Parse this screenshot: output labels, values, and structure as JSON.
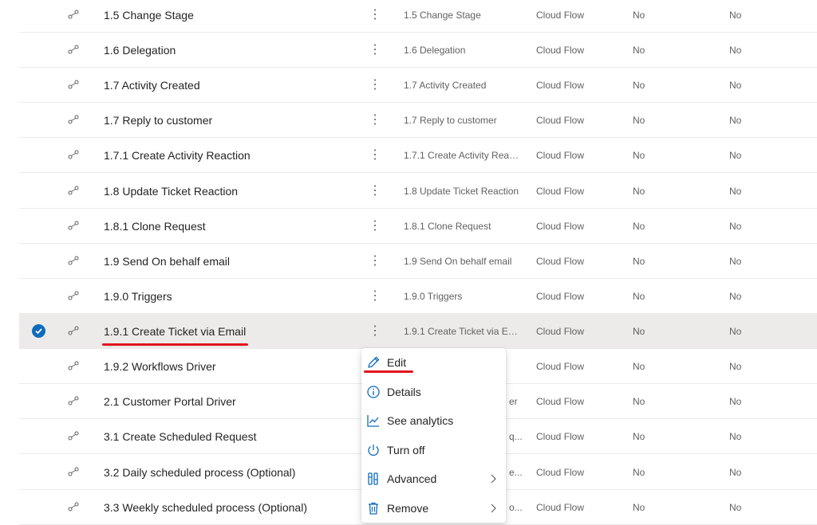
{
  "rows": [
    {
      "name": "1.5 Change Stage",
      "more": "⋮",
      "display": "1.5 Change Stage",
      "type": "Cloud Flow",
      "m1": "No",
      "m2": "No"
    },
    {
      "name": "1.6 Delegation",
      "more": "⋮",
      "display": "1.6 Delegation",
      "type": "Cloud Flow",
      "m1": "No",
      "m2": "No"
    },
    {
      "name": "1.7 Activity Created",
      "more": "⋮",
      "display": "1.7 Activity Created",
      "type": "Cloud Flow",
      "m1": "No",
      "m2": "No"
    },
    {
      "name": "1.7 Reply to customer",
      "more": "⋮",
      "display": "1.7 Reply to customer",
      "type": "Cloud Flow",
      "m1": "No",
      "m2": "No"
    },
    {
      "name": "1.7.1 Create Activity Reaction",
      "more": "⋮",
      "display": "1.7.1 Create Activity React...",
      "type": "Cloud Flow",
      "m1": "No",
      "m2": "No"
    },
    {
      "name": "1.8 Update Ticket Reaction",
      "more": "⋮",
      "display": "1.8 Update Ticket Reaction",
      "type": "Cloud Flow",
      "m1": "No",
      "m2": "No"
    },
    {
      "name": "1.8.1 Clone Request",
      "more": "⋮",
      "display": "1.8.1 Clone Request",
      "type": "Cloud Flow",
      "m1": "No",
      "m2": "No"
    },
    {
      "name": "1.9 Send On behalf email",
      "more": "⋮",
      "display": "1.9 Send On behalf email",
      "type": "Cloud Flow",
      "m1": "No",
      "m2": "No"
    },
    {
      "name": "1.9.0 Triggers",
      "more": "⋮",
      "display": "1.9.0 Triggers",
      "type": "Cloud Flow",
      "m1": "No",
      "m2": "No"
    },
    {
      "name": "1.9.1 Create Ticket via Email",
      "more": "⋮",
      "display": "1.9.1 Create Ticket via Em...",
      "type": "Cloud Flow",
      "m1": "No",
      "m2": "No",
      "selected": true
    },
    {
      "name": "1.9.2 Workflows Driver",
      "more": "",
      "display": "",
      "type": "Cloud Flow",
      "m1": "No",
      "m2": "No"
    },
    {
      "name": "2.1 Customer Portal Driver",
      "more": "",
      "display": "er",
      "type": "Cloud Flow",
      "m1": "No",
      "m2": "No"
    },
    {
      "name": "3.1 Create Scheduled Request",
      "more": "",
      "display": "q...",
      "type": "Cloud Flow",
      "m1": "No",
      "m2": "No"
    },
    {
      "name": "3.2 Daily scheduled process (Optional)",
      "more": "",
      "display": "e...",
      "type": "Cloud Flow",
      "m1": "No",
      "m2": "No"
    },
    {
      "name": "3.3 Weekly scheduled process (Optional)",
      "more": "",
      "display": "o...",
      "type": "Cloud Flow",
      "m1": "No",
      "m2": "No"
    }
  ],
  "context_menu": {
    "items": [
      {
        "label": "Edit",
        "icon": "pencil-icon"
      },
      {
        "label": "Details",
        "icon": "info-icon"
      },
      {
        "label": "See analytics",
        "icon": "chart-line-icon"
      },
      {
        "label": "Turn off",
        "icon": "power-icon"
      },
      {
        "label": "Advanced",
        "icon": "wrench-icon",
        "submenu": true
      },
      {
        "label": "Remove",
        "icon": "trash-icon",
        "submenu": true
      }
    ]
  },
  "colors": {
    "accent": "#0f6cbd",
    "annotation": "#e0141e",
    "selected_row": "#edebe9"
  }
}
